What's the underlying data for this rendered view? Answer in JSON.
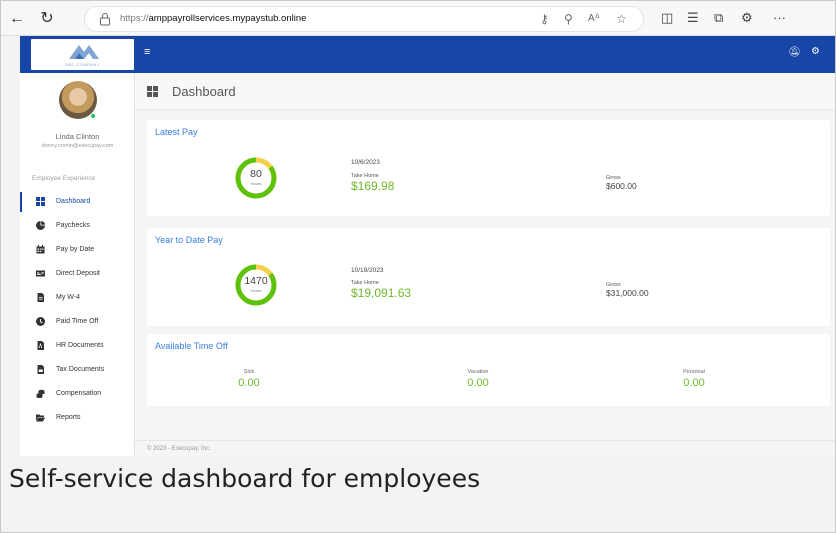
{
  "browser": {
    "url_prefix": "https://",
    "url_host": "amppayrollservices.mypaystub.online"
  },
  "app": {
    "logo_text": "ABC COMPANY",
    "page_title": "Dashboard",
    "footer": "© 2023 - Execupay, Inc."
  },
  "user": {
    "name": "Linda Clinton",
    "email": "sherry.cronin@execupay.com"
  },
  "sidebar": {
    "section_label": "Employee Experience",
    "items": [
      {
        "label": "Dashboard",
        "icon": "dashboard-icon"
      },
      {
        "label": "Paychecks",
        "icon": "pie-chart-icon"
      },
      {
        "label": "Pay by Date",
        "icon": "calendar-icon"
      },
      {
        "label": "Direct Deposit",
        "icon": "money-bill-icon"
      },
      {
        "label": "My W-4",
        "icon": "document-icon"
      },
      {
        "label": "Paid Time Off",
        "icon": "clock-icon"
      },
      {
        "label": "HR Documents",
        "icon": "pdf-file-icon"
      },
      {
        "label": "Tax Documents",
        "icon": "file-icon"
      },
      {
        "label": "Compensation",
        "icon": "coins-icon"
      },
      {
        "label": "Reports",
        "icon": "folder-open-icon"
      }
    ]
  },
  "latest_pay": {
    "title": "Latest Pay",
    "hours": "80",
    "hours_unit": "Hours",
    "date": "10/6/2023",
    "take_home_label": "Take Home",
    "take_home": "$169.98",
    "gross_label": "Gross",
    "gross": "$600.00",
    "ring_fill_fraction": 0.85
  },
  "ytd_pay": {
    "title": "Year to Date Pay",
    "hours": "1470",
    "hours_unit": "Hours",
    "date": "10/19/2023",
    "take_home_label": "Take Home",
    "take_home": "$19,091.63",
    "gross_label": "Gross",
    "gross": "$31,000.00",
    "ring_fill_fraction": 0.85
  },
  "time_off": {
    "title": "Available Time Off",
    "sick_label": "Sick",
    "sick": "0.00",
    "vacation_label": "Vacation",
    "vacation": "0.00",
    "personal_label": "Personal",
    "personal": "0.00"
  },
  "caption": "Self-service dashboard for employees",
  "colors": {
    "brand": "#1746a6",
    "accent_green": "#6fb82a",
    "ring_green": "#5cc20c",
    "ring_yellow": "#f5d04a",
    "title_blue": "#3b7ddd"
  }
}
